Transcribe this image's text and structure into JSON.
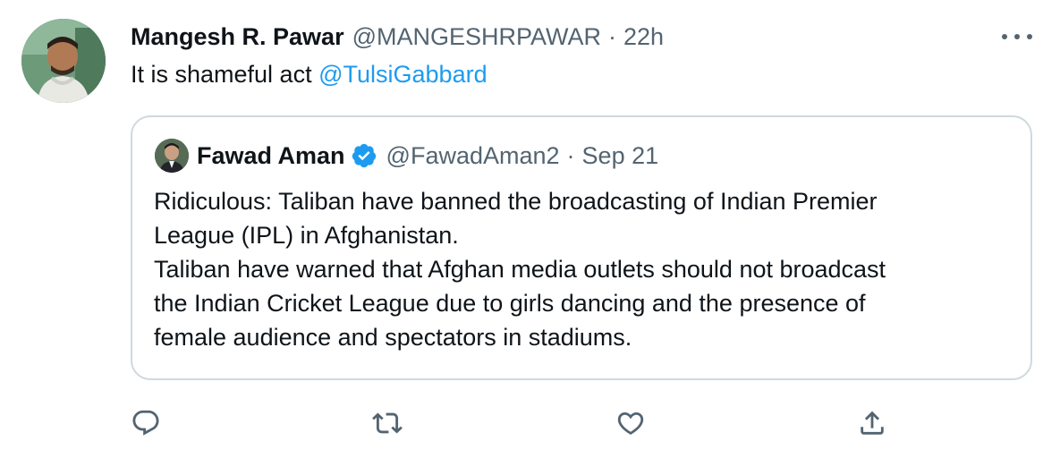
{
  "tweet": {
    "author_name": "Mangesh R. Pawar",
    "handle": "@MANGESHRPAWAR",
    "separator": "·",
    "time": "22h",
    "text": "It is shameful act",
    "mention": "@TulsiGabbard"
  },
  "quoted_tweet": {
    "author_name": "Fawad Aman",
    "verified": true,
    "handle": "@FawadAman2",
    "separator": "·",
    "date": "Sep 21",
    "lines": [
      "Ridiculous: Taliban have banned the broadcasting of Indian Premier",
      "League (IPL) in Afghanistan.",
      "Taliban have warned that Afghan media outlets should not broadcast",
      "the Indian Cricket League due to girls dancing and the presence of",
      "female audience and spectators in stadiums."
    ]
  },
  "actions": [
    "reply-icon",
    "retweet-icon",
    "like-icon",
    "share-icon"
  ],
  "colors": {
    "text": "#0f1419",
    "secondary": "#536471",
    "link": "#1d9bf0",
    "border": "#cfd9de"
  }
}
